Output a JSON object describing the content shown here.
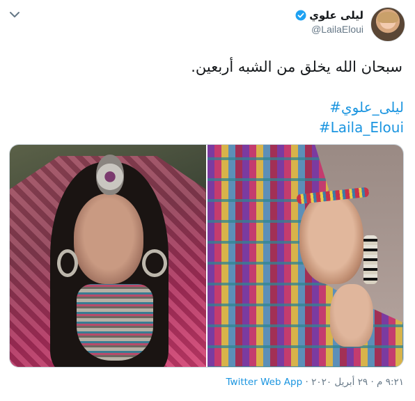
{
  "tweet": {
    "author": {
      "display_name": "ليلى علوي",
      "handle": "@LailaEloui",
      "verified": true,
      "verified_color": "#1da1f2"
    },
    "text": "سبحان الله يخلق من الشبه أربعين.",
    "hashtags": [
      "#ليلى_علوي",
      "#Laila_Eloui"
    ],
    "media": {
      "count": 2
    },
    "meta": {
      "time": "٩:٢١ م",
      "date": "٢٩ أبريل ٢٠٢٠",
      "separator": "·",
      "source_app": "Twitter Web App"
    },
    "icons": {
      "menu": "chevron-down-icon",
      "verified": "verified-badge-icon"
    },
    "colors": {
      "link": "#1b95e0",
      "secondary_text": "#657786",
      "primary_text": "#14171a"
    }
  }
}
